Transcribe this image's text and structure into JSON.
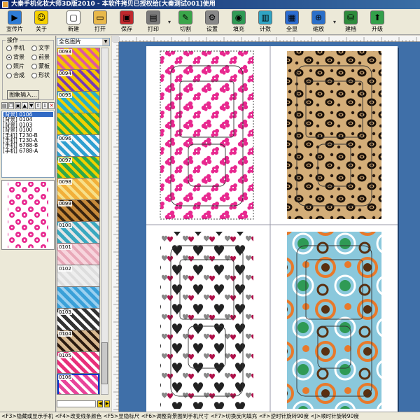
{
  "window": {
    "title": "大秦手机化妆大师3D版2010 - 本软件拷贝已授权给[大秦测试001]使用"
  },
  "toolbar": [
    {
      "label": "宣传片",
      "icon": "media-icon",
      "color": "#2e7cd6"
    },
    {
      "label": "关于",
      "icon": "smiley-icon",
      "color": "#f5d000"
    },
    {
      "label": "新建",
      "icon": "new-file-icon",
      "color": "#ffffff"
    },
    {
      "label": "打开",
      "icon": "open-folder-icon",
      "color": "#e8b84a"
    },
    {
      "label": "保存",
      "icon": "save-disk-icon",
      "color": "#c0282d"
    },
    {
      "label": "打印",
      "icon": "printer-icon",
      "color": "#7a7a7a"
    },
    {
      "label": "切割",
      "icon": "cutter-icon",
      "color": "#3aa54a"
    },
    {
      "label": "设置",
      "icon": "settings-icon",
      "color": "#888888"
    },
    {
      "label": "填充",
      "icon": "fill-icon",
      "color": "#2f9a55"
    },
    {
      "label": "计数",
      "icon": "counter-icon",
      "color": "#2fa4c4"
    },
    {
      "label": "全显",
      "icon": "monitor-icon",
      "color": "#2b6cd1"
    },
    {
      "label": "缩放",
      "icon": "zoom-icon",
      "color": "#2a6fc9"
    },
    {
      "label": "建档",
      "icon": "archive-icon",
      "color": "#2e8b3c"
    },
    {
      "label": "升级",
      "icon": "upgrade-icon",
      "color": "#33a04a"
    }
  ],
  "ops": {
    "title": "操作",
    "radios": [
      {
        "label": "手机",
        "checked": false
      },
      {
        "label": "文字",
        "checked": false
      },
      {
        "label": "背景",
        "checked": true
      },
      {
        "label": "前景",
        "checked": false
      },
      {
        "label": "照片",
        "checked": false
      },
      {
        "label": "蒙板",
        "checked": false
      },
      {
        "label": "合成",
        "checked": false
      },
      {
        "label": "形状",
        "checked": false
      }
    ],
    "import_button": "图象输入..."
  },
  "layers": [
    {
      "label": "[背景] 0106",
      "selected": true
    },
    {
      "label": "[背景] 0104",
      "selected": false
    },
    {
      "label": "[背景] 0103",
      "selected": false
    },
    {
      "label": "[背景] 0100",
      "selected": false
    },
    {
      "label": "[手机] T230-B",
      "selected": false
    },
    {
      "label": "[手机] T230-A",
      "selected": false
    },
    {
      "label": "[手机] 6788-B",
      "selected": false
    },
    {
      "label": "[手机] 6788-A",
      "selected": false
    }
  ],
  "thumbnails": {
    "dropdown": "全包图片",
    "items": [
      {
        "num": "0093",
        "color1": "#f5c400",
        "color2": "#e05a9a"
      },
      {
        "num": "0094",
        "color1": "#f5c400",
        "color2": "#7a3ab0"
      },
      {
        "num": "0095",
        "color1": "#28b0c8",
        "color2": "#f2d000"
      },
      {
        "num": "",
        "color1": "#f2d000",
        "color2": "#2fa84a"
      },
      {
        "num": "0096",
        "color1": "#2f9fd0",
        "color2": "#f5f5f5"
      },
      {
        "num": "0097",
        "color1": "#2fa84a",
        "color2": "#f2d000"
      },
      {
        "num": "0098",
        "color1": "#f2b03a",
        "color2": "#f7e08a"
      },
      {
        "num": "0099",
        "color1": "#c88a3a",
        "color2": "#3a2510"
      },
      {
        "num": "0100",
        "color1": "#3aa8c0",
        "color2": "#e6e6e6"
      },
      {
        "num": "0101",
        "color1": "#f7d5dd",
        "color2": "#e8a8b8"
      },
      {
        "num": "0102",
        "color1": "#eeeeee",
        "color2": "#dddddd"
      },
      {
        "num": "",
        "color1": "#3aa0d8",
        "color2": "#9ad0f0"
      },
      {
        "num": "0103",
        "color1": "#333333",
        "color2": "#ffffff"
      },
      {
        "num": "0104",
        "color1": "#d8b890",
        "color2": "#2a1a10"
      },
      {
        "num": "0105",
        "color1": "#e8307a",
        "color2": "#ffffff"
      },
      {
        "num": "0106",
        "color1": "#e8449a",
        "color2": "#ffffff",
        "selected": true
      }
    ]
  },
  "covers": [
    {
      "name": "pink-floral-cover",
      "color1": "#ffffff",
      "color2": "#e8288f"
    },
    {
      "name": "leopard-cover",
      "color1": "#c99a5a",
      "color2": "#1a1008"
    },
    {
      "name": "hearts-cover",
      "color1": "#ffffff",
      "color2": "#222222"
    },
    {
      "name": "circles-cover",
      "color1": "#8ac8dc",
      "color2": "#e8792a"
    }
  ],
  "statusbar": "<F3>隐藏或显示手机 <F4>改变线条颜色 <F5>显隐标尺 <F6>调整背景图到手机尺寸 <F7>切换反向填充 <F>逆时针旋转90度 <J>顺时针旋转90度"
}
